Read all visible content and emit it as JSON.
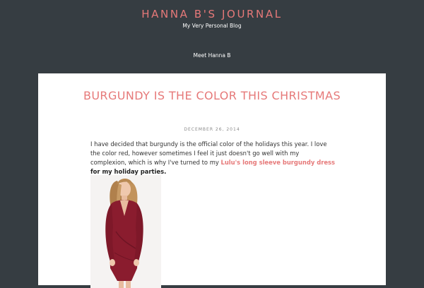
{
  "site": {
    "title": "HANNA B'S JOURNAL",
    "tagline": "My Very Personal Blog"
  },
  "nav": {
    "items": [
      {
        "label": "Meet Hanna B"
      }
    ]
  },
  "post": {
    "title": "BURGUNDY IS THE COLOR THIS CHRISTMAS",
    "date": "DECEMBER 26, 2014",
    "body_text": "I have decided that burgundy is the official color of the holidays this year. I love the color red, however sometimes I feel it just doesn't go well with my complexion, which is why I've turned to my ",
    "link_text": "Lulu's long sleeve burgundy dress",
    "bold_text": " for my holiday parties.",
    "image_alt": "Model in burgundy long sleeve dress"
  },
  "colors": {
    "background": "#363d42",
    "accent": "#e67979",
    "content_bg": "#ffffff",
    "dress": "#8a1c2e"
  }
}
